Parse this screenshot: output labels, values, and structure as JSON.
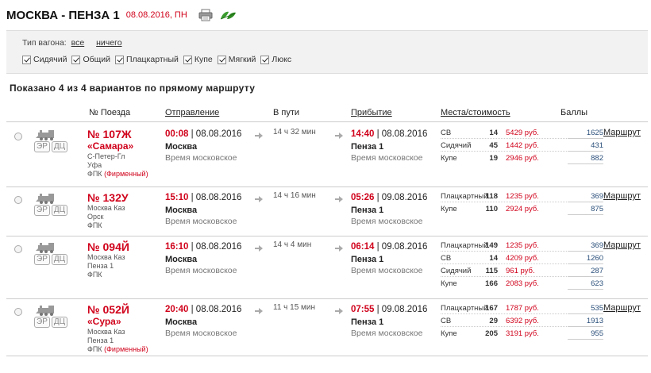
{
  "header": {
    "title": "МОСКВА - ПЕНЗА 1",
    "date": "08.08.2016, ПН",
    "print_icon": "printer-icon",
    "eco_icon": "leaf-icon"
  },
  "filter": {
    "label": "Тип вагона:",
    "all_link": "все",
    "none_link": "ничего",
    "types": [
      "Сидячий",
      "Общий",
      "Плацкартный",
      "Купе",
      "Мягкий",
      "Люкс"
    ]
  },
  "summary": "Показано 4 из 4 вариантов по прямому маршруту",
  "columns": {
    "train": "№ Поезда",
    "departure": "Отправление",
    "duration": "В пути",
    "arrival": "Прибытие",
    "seats": "Места/стоимость",
    "score": "Баллы"
  },
  "badges": [
    "ЭР",
    "ДЦ"
  ],
  "route_link": "Маршрут",
  "timezone": "Время московское",
  "trains": [
    {
      "num": "№ 107Ж",
      "name": "«Самара»",
      "from": "С-Петер-Гл",
      "to": "Уфа",
      "carrier": "ФПК",
      "carrier_note": "(Фирменный)",
      "dep_time": "00:08",
      "dep_date": "| 08.08.2016",
      "dep_city": "Москва",
      "duration": "14 ч 32 мин",
      "arr_time": "14:40",
      "arr_date": "| 08.08.2016",
      "arr_city": "Пенза 1",
      "seats": [
        {
          "cls": "СВ",
          "count": "14",
          "price": "5429 руб.",
          "score": "1625"
        },
        {
          "cls": "Сидячий",
          "count": "45",
          "price": "1442 руб.",
          "score": "431"
        },
        {
          "cls": "Купе",
          "count": "19",
          "price": "2946 руб.",
          "score": "882"
        }
      ]
    },
    {
      "num": "№ 132У",
      "name": "",
      "from": "Москва Каз",
      "to": "Орск",
      "carrier": "ФПК",
      "carrier_note": "",
      "dep_time": "15:10",
      "dep_date": "| 08.08.2016",
      "dep_city": "Москва",
      "duration": "14 ч 16 мин",
      "arr_time": "05:26",
      "arr_date": "| 09.08.2016",
      "arr_city": "Пенза 1",
      "seats": [
        {
          "cls": "Плацкартный",
          "count": "118",
          "price": "1235 руб.",
          "score": "369"
        },
        {
          "cls": "Купе",
          "count": "110",
          "price": "2924 руб.",
          "score": "875"
        }
      ]
    },
    {
      "num": "№ 094Й",
      "name": "",
      "from": "Москва Каз",
      "to": "Пенза 1",
      "carrier": "ФПК",
      "carrier_note": "",
      "dep_time": "16:10",
      "dep_date": "| 08.08.2016",
      "dep_city": "Москва",
      "duration": "14 ч 4 мин",
      "arr_time": "06:14",
      "arr_date": "| 09.08.2016",
      "arr_city": "Пенза 1",
      "seats": [
        {
          "cls": "Плацкартный",
          "count": "149",
          "price": "1235 руб.",
          "score": "369"
        },
        {
          "cls": "СВ",
          "count": "14",
          "price": "4209 руб.",
          "score": "1260"
        },
        {
          "cls": "Сидячий",
          "count": "115",
          "price": "961 руб.",
          "score": "287"
        },
        {
          "cls": "Купе",
          "count": "166",
          "price": "2083 руб.",
          "score": "623"
        }
      ]
    },
    {
      "num": "№ 052Й",
      "name": "«Сура»",
      "from": "Москва Каз",
      "to": "Пенза 1",
      "carrier": "ФПК",
      "carrier_note": "(Фирменный)",
      "dep_time": "20:40",
      "dep_date": "| 08.08.2016",
      "dep_city": "Москва",
      "duration": "11 ч 15 мин",
      "arr_time": "07:55",
      "arr_date": "| 09.08.2016",
      "arr_city": "Пенза 1",
      "seats": [
        {
          "cls": "Плацкартный",
          "count": "167",
          "price": "1787 руб.",
          "score": "535"
        },
        {
          "cls": "СВ",
          "count": "29",
          "price": "6392 руб.",
          "score": "1913"
        },
        {
          "cls": "Купе",
          "count": "205",
          "price": "3191 руб.",
          "score": "955"
        }
      ]
    }
  ]
}
